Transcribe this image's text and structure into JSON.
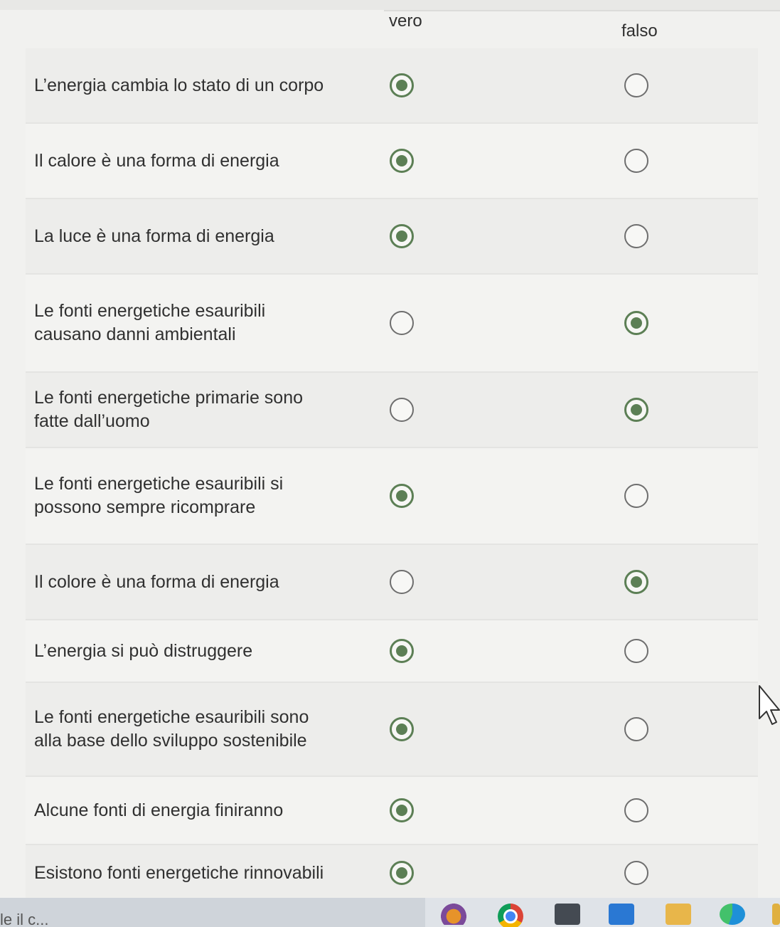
{
  "columns": {
    "vero": "vero",
    "falso": "falso"
  },
  "questions": [
    {
      "text": "L’energia cambia lo stato di un corpo",
      "answer": "vero"
    },
    {
      "text": "Il calore è una forma di energia",
      "answer": "vero"
    },
    {
      "text": "La luce è una forma di energia",
      "answer": "vero"
    },
    {
      "text": "Le fonti energetiche esauribili causano danni ambientali",
      "answer": "falso"
    },
    {
      "text": "Le fonti energetiche primarie sono fatte dall’uomo",
      "answer": "falso"
    },
    {
      "text": "Le fonti energetiche esauribili si possono sempre ricomprare",
      "answer": "vero"
    },
    {
      "text": "Il colore è una forma di energia",
      "answer": "falso"
    },
    {
      "text": "L’energia si può distruggere",
      "answer": "vero"
    },
    {
      "text": "Le fonti energetiche esauribili sono alla base dello sviluppo sostenibile",
      "answer": "vero"
    },
    {
      "text": "Alcune fonti di energia finiranno",
      "answer": "vero"
    },
    {
      "text": "Esistono fonti energetiche rinnovabili",
      "answer": "vero"
    }
  ],
  "taskbar": {
    "search_text": "le il c...",
    "icons": [
      "weather-icon",
      "chrome-icon",
      "calculator-icon",
      "outlook-icon",
      "file-explorer-icon",
      "edge-icon"
    ]
  },
  "colors": {
    "checked": "#5c7f55",
    "background": "#f1f1ef"
  }
}
